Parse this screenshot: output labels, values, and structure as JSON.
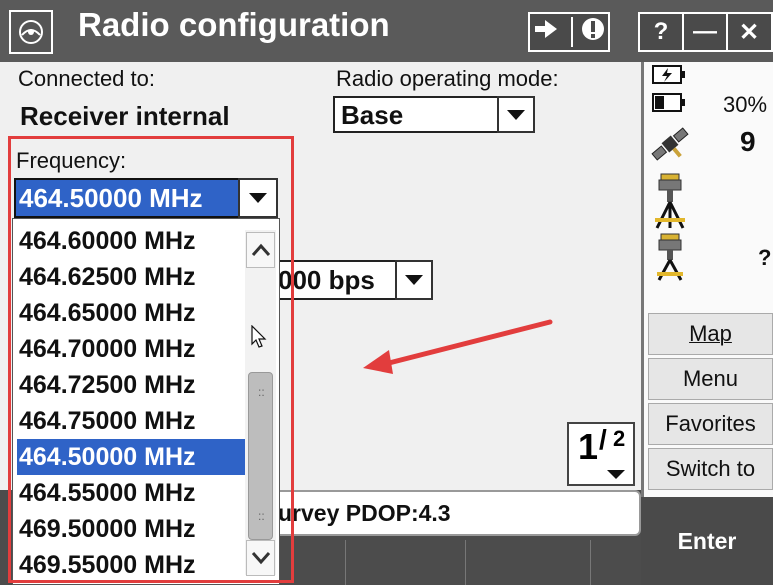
{
  "window": {
    "title": "Radio configuration",
    "help_label": "?",
    "minimize_label": "—",
    "close_label": "✕"
  },
  "connected": {
    "label": "Connected to:",
    "value": "Receiver internal"
  },
  "mode": {
    "label": "Radio operating mode:",
    "value": "Base"
  },
  "frequency": {
    "label": "Frequency:",
    "value": "464.50000 MHz",
    "options": [
      "464.60000 MHz",
      "464.62500 MHz",
      "464.65000 MHz",
      "464.70000 MHz",
      "464.72500 MHz",
      "464.75000 MHz",
      "464.50000 MHz",
      "464.55000 MHz",
      "469.50000 MHz",
      "469.55000 MHz"
    ],
    "selected_index": 6
  },
  "baud": {
    "value_partial": "000 bps"
  },
  "page_indicator": {
    "current": "1",
    "total": "2"
  },
  "status_line": "urvey  PDOP:4.3",
  "side": {
    "battery_percent": "30%",
    "satellites": "9",
    "unknown": "?",
    "buttons": [
      "Map",
      "Menu",
      "Favorites",
      "Switch to"
    ]
  },
  "enter_label": "Enter",
  "colors": {
    "titlebar": "#5a5a5a",
    "selection": "#2f63c7",
    "annotation": "#e23d3d"
  }
}
